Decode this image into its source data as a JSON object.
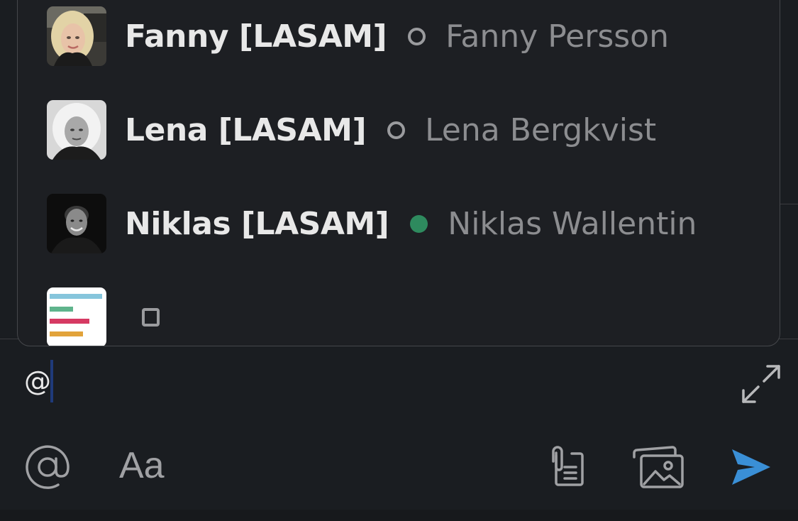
{
  "mention_popup": {
    "items": [
      {
        "display_name": "Fanny [LASAM]",
        "real_name": "Fanny Persson",
        "presence": "away"
      },
      {
        "display_name": "Lena [LASAM]",
        "real_name": "Lena Bergkvist",
        "presence": "away"
      },
      {
        "display_name": "Niklas [LASAM]",
        "real_name": "Niklas Wallentin",
        "presence": "active"
      },
      {
        "display_name": "",
        "real_name": "",
        "presence": "app"
      }
    ]
  },
  "composer": {
    "text": "@"
  },
  "toolbar": {
    "mention_icon": "at-icon",
    "format_label": "Aa",
    "attach_icon": "attach-file-icon",
    "photo_icon": "photo-gallery-icon",
    "send_icon": "send-icon",
    "expand_icon": "expand-icon"
  },
  "colors": {
    "background": "#1a1d21",
    "popup_bg": "#1d1f23",
    "text_primary": "#e8e8e8",
    "text_secondary": "#8c8d90",
    "presence_active": "#2e8a5e",
    "send_blue": "#3a8fd6"
  }
}
